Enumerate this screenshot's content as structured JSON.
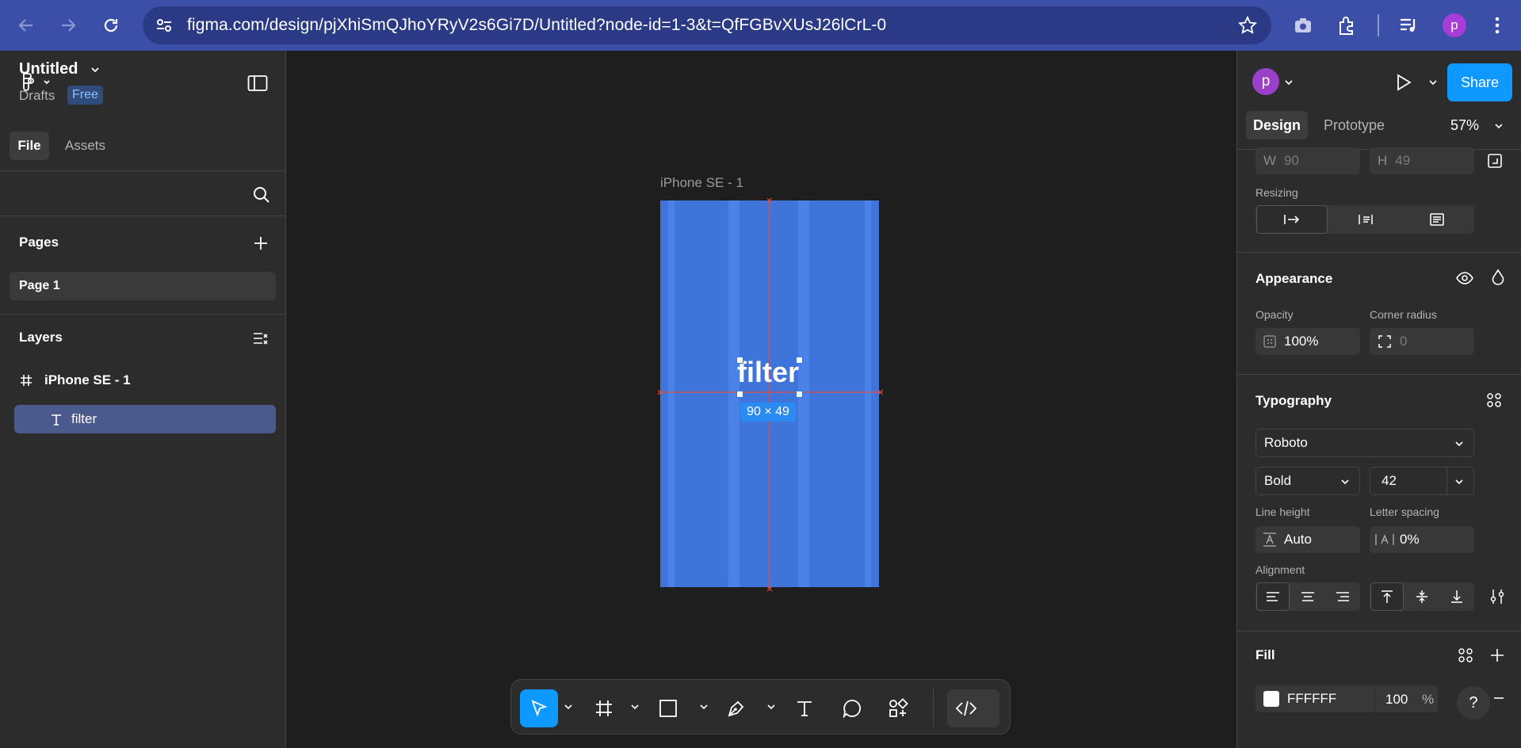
{
  "browser": {
    "url": "figma.com/design/pjXhiSmQJhoYRyV2s6Gi7D/Untitled?node-id=1-3&t=QfFGBvXUsJ26lCrL-0",
    "profile_initial": "p"
  },
  "left_panel": {
    "file_title": "Untitled",
    "drafts_label": "Drafts",
    "plan_badge": "Free",
    "tabs": {
      "file": "File",
      "assets": "Assets"
    },
    "pages_heading": "Pages",
    "pages": [
      "Page 1"
    ],
    "layers_heading": "Layers",
    "layers": [
      {
        "name": "iPhone SE - 1",
        "type": "frame"
      },
      {
        "name": "filter",
        "type": "text"
      }
    ]
  },
  "canvas": {
    "frame_label": "iPhone SE - 1",
    "selected_text": "filter",
    "dimensions_badge": "90 × 49"
  },
  "right_panel": {
    "user_initial": "p",
    "share_label": "Share",
    "tabs": {
      "design": "Design",
      "prototype": "Prototype"
    },
    "zoom": "57%",
    "width_label": "W",
    "width_value": "90",
    "height_label": "H",
    "height_value": "49",
    "resizing_label": "Resizing",
    "appearance_heading": "Appearance",
    "opacity_label": "Opacity",
    "opacity_value": "100%",
    "corner_radius_label": "Corner radius",
    "corner_radius_value": "0",
    "typography_heading": "Typography",
    "font_family": "Roboto",
    "font_weight": "Bold",
    "font_size": "42",
    "line_height_label": "Line height",
    "line_height_value": "Auto",
    "letter_spacing_label": "Letter spacing",
    "letter_spacing_value": "0%",
    "alignment_label": "Alignment",
    "fill_heading": "Fill",
    "fill_hex": "FFFFFF",
    "fill_opacity": "100",
    "fill_opacity_unit": "%",
    "help_label": "?"
  },
  "colors": {
    "browser_bar": "#3c4fa8",
    "accent": "#0d99ff",
    "frame_fill": "#3f74db",
    "panel_bg": "#2c2c2c",
    "canvas_bg": "#1e1e1e"
  }
}
